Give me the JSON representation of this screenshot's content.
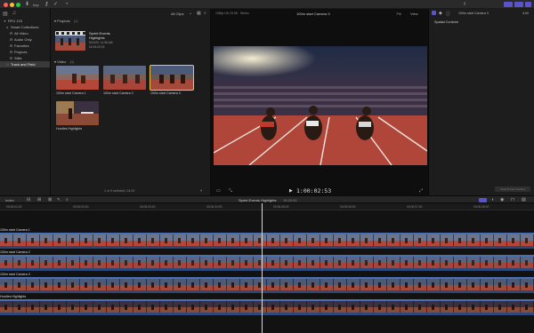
{
  "colors": {
    "close": "#ff5f57",
    "minimize": "#febc2e",
    "maximize": "#28c840",
    "clip_blue": "#4a6fb3",
    "accent_purple": "#5a53c9",
    "selection": "#f4c542"
  },
  "toolbar": {
    "icons": [
      "import-icon",
      "key-icon",
      "check-icon",
      "sync-icon"
    ],
    "label": "Imp"
  },
  "sidebar": {
    "library": "RFU 120",
    "items": [
      {
        "label": "Smart Collections",
        "icon": "folder-icon"
      },
      {
        "label": "All Video",
        "icon": "gear-icon"
      },
      {
        "label": "Audio Only",
        "icon": "gear-icon"
      },
      {
        "label": "Favorites",
        "icon": "gear-icon"
      },
      {
        "label": "Projects",
        "icon": "gear-icon"
      },
      {
        "label": "Stills",
        "icon": "gear-icon"
      },
      {
        "label": "Track and Field",
        "icon": "star-icon"
      }
    ]
  },
  "browser": {
    "filter": "All Clips",
    "projects_label": "Projects",
    "projects_count": "(1)",
    "project": {
      "name_line1": "Sprint Events",
      "name_line2": "Highlights",
      "date": "5/10/20, 11:36 AM",
      "duration": "00:19:20:02"
    },
    "video_label": "Video",
    "video_count": "(4)",
    "clips": [
      {
        "label": "100m start Camera 1"
      },
      {
        "label": "100m start Camera 2"
      },
      {
        "label": "100m start Camera 3"
      },
      {
        "label": "Hurdles Highlights"
      }
    ],
    "status": "1 of 5 selected, 04:00"
  },
  "viewer": {
    "format": "1080p HD 23.98 · Stereo",
    "title": "100m start Camera 3",
    "zoom": "7%",
    "view": "View",
    "timecode": "1:00:02:53"
  },
  "inspector": {
    "title": "100m start Camera 3",
    "duration": "4:00",
    "section": "Spatial Conform",
    "button": "Clear Project Setting"
  },
  "timeline": {
    "index": "Index",
    "project": "Sprint Events Highlights",
    "duration": "19:20:02",
    "ruler": [
      "00:00:01:00",
      "00:00:02:00",
      "00:00:03:00",
      "00:00:04:00",
      "00:00:05:00",
      "00:00:06:00",
      "00:00:07:00",
      "00:00:08:00"
    ],
    "tracks": [
      {
        "label": "100m start Camera 1"
      },
      {
        "label": "100m start Camera 2"
      },
      {
        "label": "100m start Camera 3"
      },
      {
        "label": "Hurdles Highlights"
      }
    ]
  }
}
